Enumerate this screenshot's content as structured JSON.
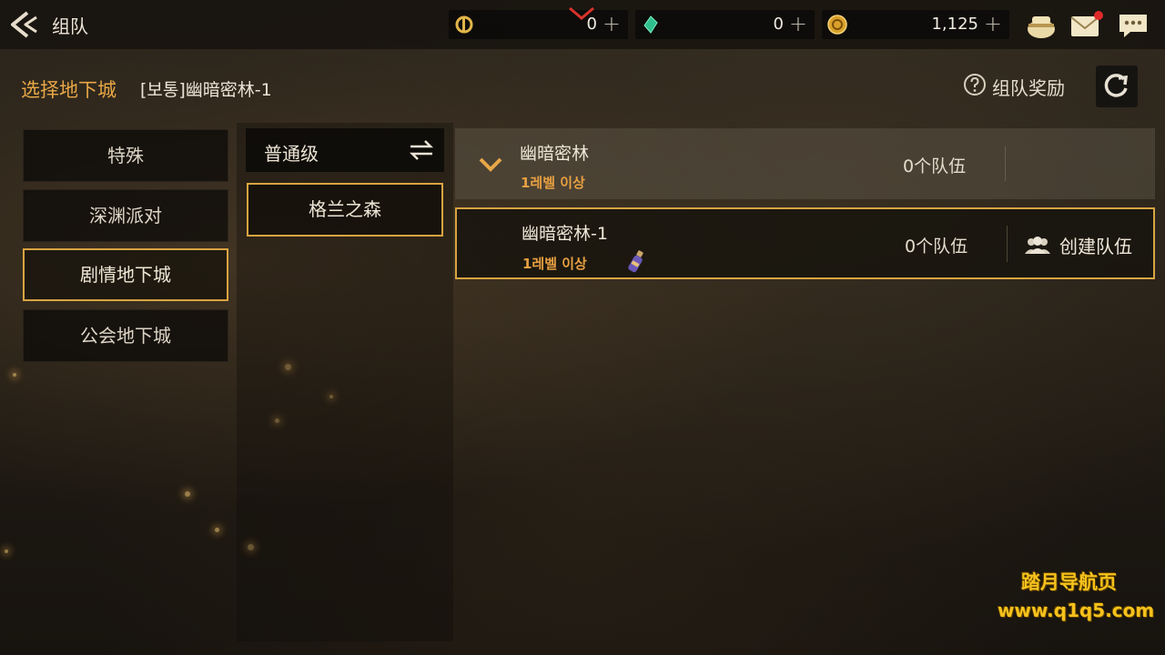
{
  "header": {
    "title": "组队",
    "currencies": [
      {
        "icon": "cera-coin-icon",
        "value": "0"
      },
      {
        "icon": "crystal-icon",
        "value": "0"
      },
      {
        "icon": "gold-coin-icon",
        "value": "1,125"
      }
    ],
    "plus_symbol": "+",
    "icons": [
      "pouch-icon",
      "mail-icon",
      "chat-icon"
    ]
  },
  "selection": {
    "label": "选择地下城",
    "current": "[보통]幽暗密林-1",
    "reward_label": "组队奖励"
  },
  "categories": [
    {
      "label": "特殊",
      "active": false
    },
    {
      "label": "深渊派对",
      "active": false
    },
    {
      "label": "剧情地下城",
      "active": true
    },
    {
      "label": "公会地下城",
      "active": false
    }
  ],
  "difficulty": {
    "label": "普通级"
  },
  "regions": [
    {
      "label": "格兰之森",
      "active": true
    }
  ],
  "dungeons": {
    "group": {
      "name": "幽暗密林",
      "level": "1레벨 이상",
      "teams": "0个队伍"
    },
    "items": [
      {
        "name": "幽暗密林-1",
        "level": "1레벨 이상",
        "teams": "0个队伍",
        "action": "创建队伍"
      }
    ]
  },
  "watermark": {
    "line1": "踏月导航页",
    "line2": "www.q1q5.com"
  },
  "colors": {
    "accent": "#e8a746",
    "border_gold": "#d9a441",
    "watermark": "#f6c21c"
  }
}
